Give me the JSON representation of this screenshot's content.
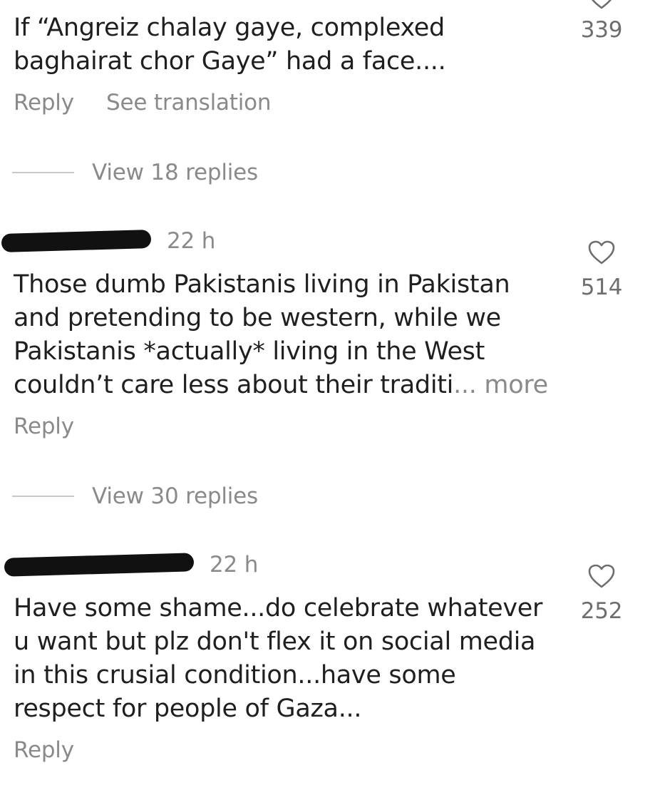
{
  "comments": [
    {
      "text": "If “Angreiz chalay gaye, complexed\nbaghairat chor Gaye” had a face....",
      "likes": "339",
      "reply_label": "Reply",
      "translate_label": "See translation",
      "view_replies": "View 18 replies"
    },
    {
      "time": "22 h",
      "text": "Those dumb Pakistanis living in Pakistan\nand pretending to be western, while we\nPakistanis *actually* living in the West\ncouldn’t care less about their traditi",
      "more_label": "... more",
      "likes": "514",
      "reply_label": "Reply",
      "view_replies": "View 30 replies"
    },
    {
      "time": "22 h",
      "text": "Have some shame...do celebrate whatever\nu want but plz don't flex it on social media\nin this crusial condition...have some\nrespect for people of Gaza...",
      "likes": "252",
      "reply_label": "Reply"
    }
  ],
  "icons": {
    "like": "heart-outline-icon",
    "redaction": "redacted-username"
  },
  "colors": {
    "text": "#1f1f1f",
    "secondary": "#8a8a8a",
    "divider": "#c8c8c8"
  }
}
